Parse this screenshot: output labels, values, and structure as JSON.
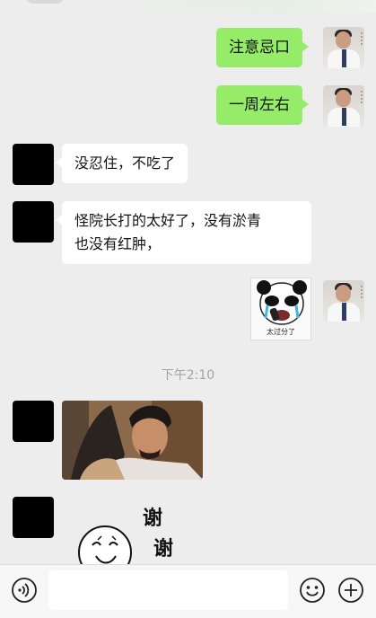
{
  "messages": {
    "sent_1": "注意忌口",
    "sent_2": "一周左右",
    "received_1": "没忍住，不吃了",
    "received_2_line1": "怪院长打的太好了，没有淤青",
    "received_2_line2": "也没有红肿，",
    "sticker_caption": "太过分了",
    "thanks_char_1": "谢",
    "thanks_char_2": "谢"
  },
  "timestamp": "下午2:10",
  "input_bar": {
    "voice_icon": "voice-icon",
    "emoji_icon": "emoji-icon",
    "plus_icon": "plus-icon"
  },
  "colors": {
    "sent_bubble": "#95ec69",
    "received_bubble": "#ffffff",
    "background": "#ededed"
  }
}
